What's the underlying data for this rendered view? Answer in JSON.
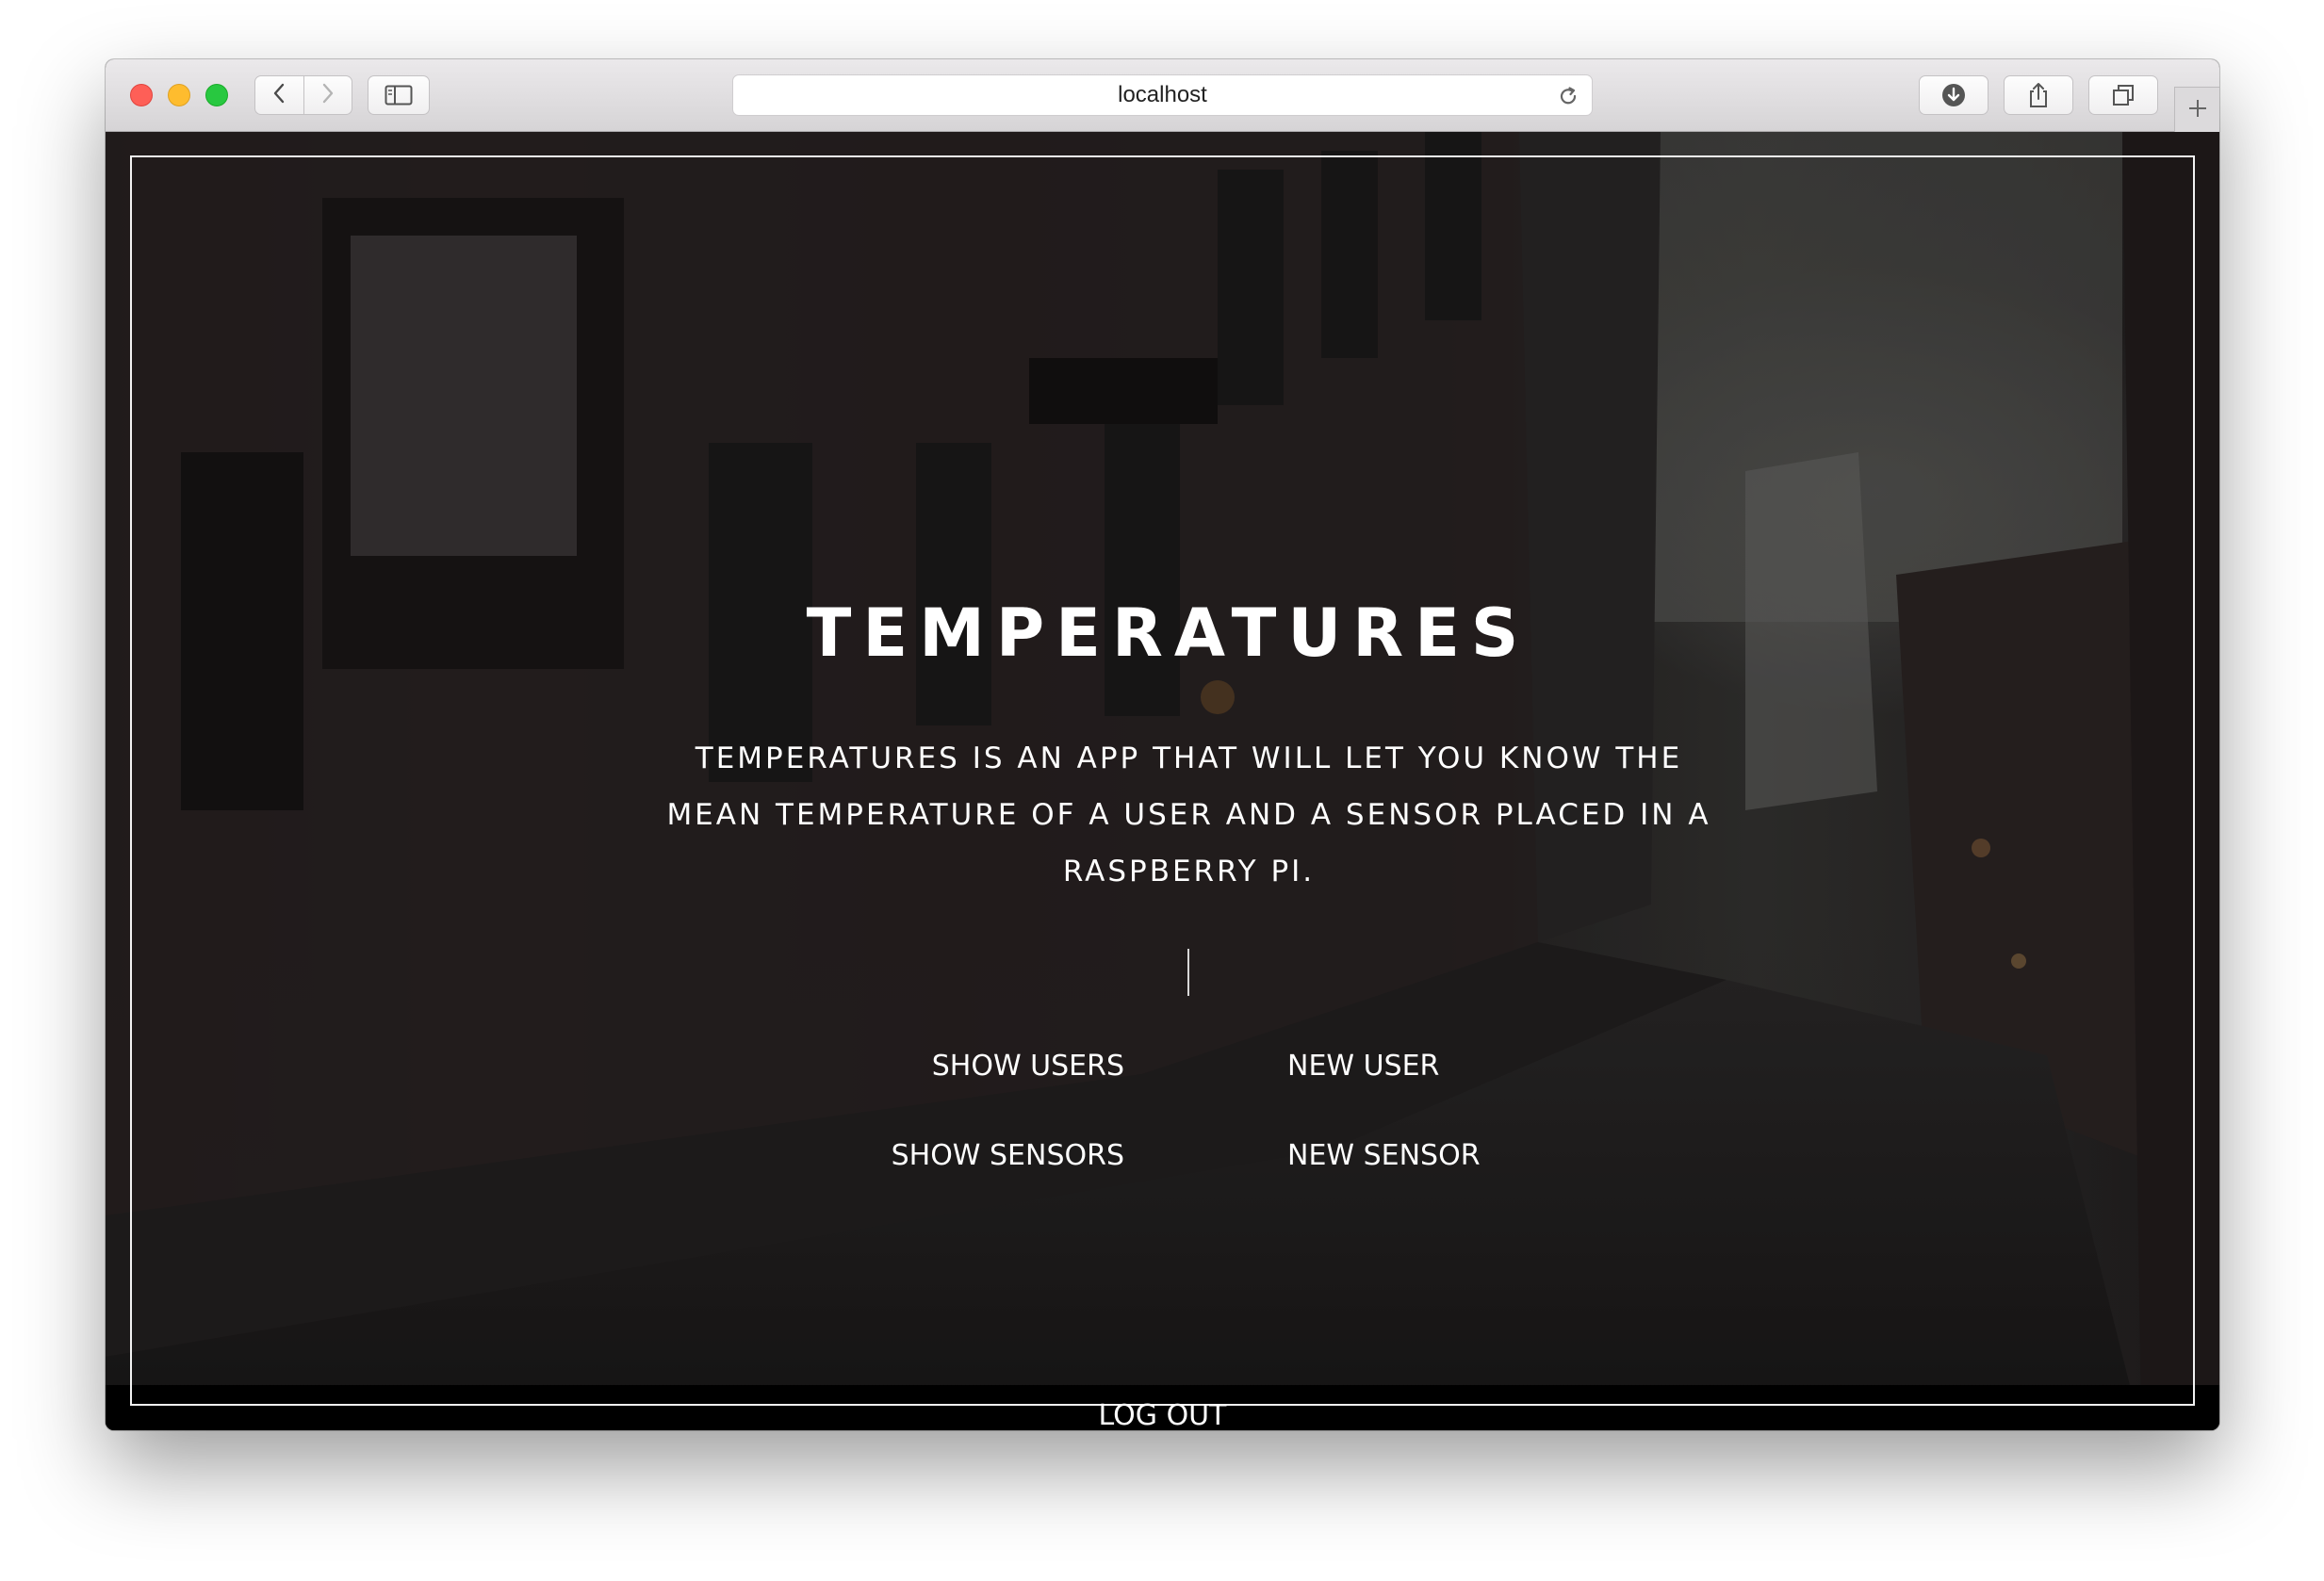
{
  "browser": {
    "url": "localhost",
    "colors": {
      "close": "#fe5f57",
      "minimize": "#febc2e",
      "maximize": "#28c840"
    },
    "icons": [
      "back-icon",
      "forward-icon",
      "sidebar-icon",
      "reload-icon",
      "download-icon",
      "share-icon",
      "tabs-icon",
      "new-tab-icon"
    ]
  },
  "page": {
    "title": "TEMPERATURES",
    "description": "Temperatures is an app that will let you know the mean temperature of a user and a sensor placed in a Raspberry Pi.",
    "links": {
      "show_users": "SHOW USERS",
      "show_sensors": "SHOW SENSORS",
      "new_user": "NEW USER",
      "new_sensor": "NEW SENSOR",
      "log_out": "LOG OUT"
    },
    "colors": {
      "text": "#ffffff",
      "frame": "#f2f2f2"
    }
  }
}
